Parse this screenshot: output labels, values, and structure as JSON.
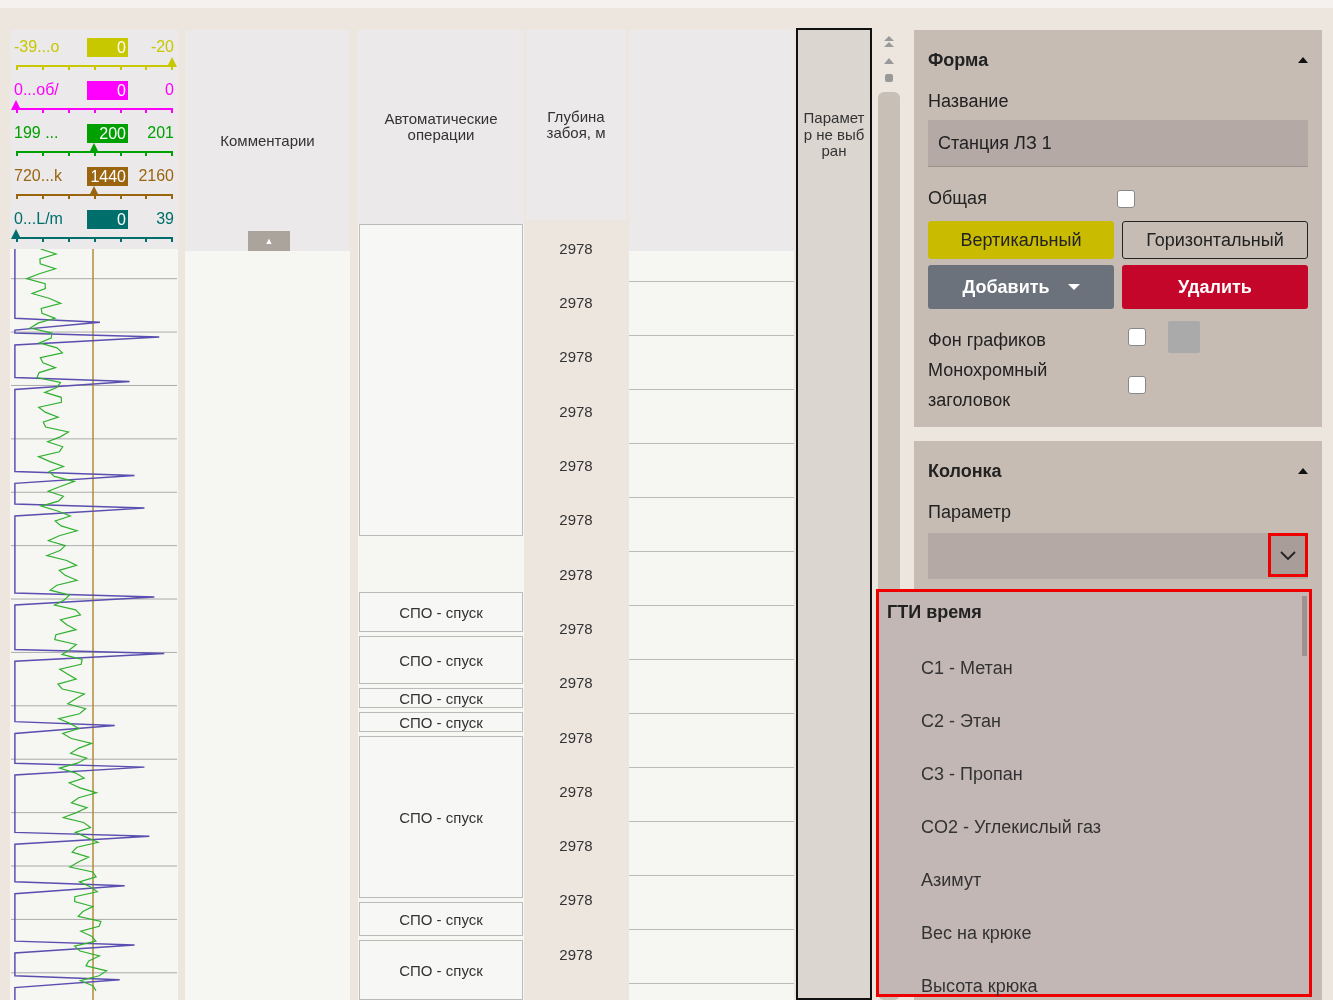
{
  "legend": [
    {
      "min": "-39...о",
      "value": "0",
      "max": "-20",
      "color": "#c8c800",
      "level": 1
    },
    {
      "min": "0...об/",
      "value": "0",
      "max": "0",
      "color": "#ff00ff",
      "level": 0
    },
    {
      "min": "199 ...",
      "value": "200",
      "max": "201",
      "color": "#00a000",
      "level": 0.5
    },
    {
      "min": "720...k",
      "value": "1440",
      "max": "2160",
      "color": "#9b6510",
      "level": 0.5
    },
    {
      "min": "0...L/m",
      "value": "0",
      "max": "39",
      "color": "#006e6a",
      "level": 0
    }
  ],
  "comments": {
    "title": "Комментарии",
    "toggle": "▲"
  },
  "operations": {
    "title": "Автоматические операции",
    "items": [
      {
        "kind": "empty"
      },
      {
        "kind": "gap"
      },
      {
        "kind": "operation",
        "label": "СПО - спуск"
      },
      {
        "kind": "operation",
        "label": "СПО - спуск"
      },
      {
        "kind": "operation",
        "label": "СПО - спуск"
      },
      {
        "kind": "operation",
        "label": "СПО - спуск"
      },
      {
        "kind": "operation",
        "label": "СПО - спуск"
      },
      {
        "kind": "operation",
        "label": "СПО - спуск"
      },
      {
        "kind": "operation",
        "label": "СПО - спуск"
      }
    ]
  },
  "depth": {
    "title": "Глубина забоя, м",
    "values": [
      "2978",
      "2978",
      "2978",
      "2978",
      "2978",
      "2978",
      "2978",
      "2978",
      "2978",
      "2978",
      "2978",
      "2978",
      "2978",
      "2978"
    ]
  },
  "parameter_column": {
    "title": "Параметр не выбран"
  },
  "form": {
    "title": "Форма",
    "name_label": "Название",
    "name_value": "Станция ЛЗ 1",
    "common_label": "Общая",
    "common_checked": false,
    "orientation": [
      {
        "label": "Вертикальный",
        "selected": true
      },
      {
        "label": "Горизонтальный",
        "selected": false
      }
    ],
    "add_button": "Добавить",
    "delete_button": "Удалить",
    "background_label": "Фон графиков",
    "background_checked": false,
    "mono_label": "Монохромный заголовок",
    "mono_checked": false
  },
  "column_panel": {
    "title": "Колонка",
    "parameter_label": "Параметр",
    "dropdown_open": true,
    "options": [
      {
        "kind": "group",
        "label": "ГТИ время"
      },
      {
        "kind": "option",
        "label": "C1 - Метан"
      },
      {
        "kind": "option",
        "label": "C2 - Этан"
      },
      {
        "kind": "option",
        "label": "C3 - Пропан"
      },
      {
        "kind": "option",
        "label": "CO2 - Углекислый газ"
      },
      {
        "kind": "option",
        "label": "Азимут"
      },
      {
        "kind": "option",
        "label": "Вес на крюке"
      },
      {
        "kind": "option",
        "label": "Высота крюка"
      }
    ]
  }
}
